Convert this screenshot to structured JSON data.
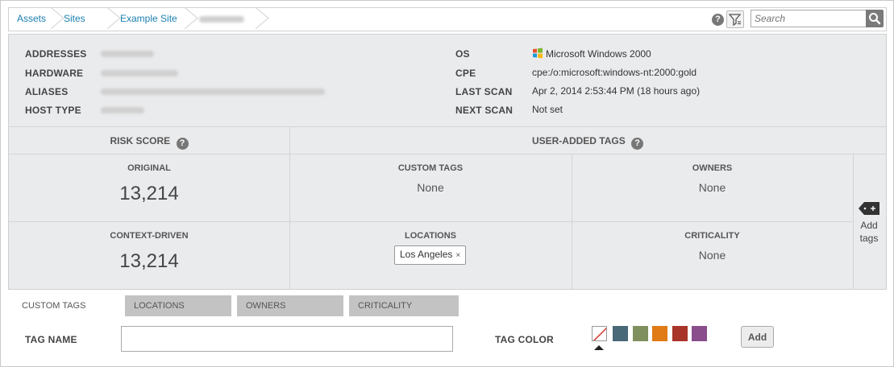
{
  "breadcrumb": {
    "items": [
      "Assets",
      "Sites",
      "Example Site"
    ]
  },
  "search": {
    "placeholder": "Search"
  },
  "summary": {
    "labels": {
      "addresses": "ADDRESSES",
      "hardware": "HARDWARE",
      "aliases": "ALIASES",
      "host_type": "HOST TYPE",
      "os": "OS",
      "cpe": "CPE",
      "last_scan": "LAST SCAN",
      "next_scan": "NEXT SCAN"
    },
    "values": {
      "os": "Microsoft Windows 2000",
      "cpe": "cpe:/o:microsoft:windows-nt:2000:gold",
      "last_scan": "Apr 2, 2014 2:53:44 PM (18 hours ago)",
      "next_scan": "Not set"
    }
  },
  "risk": {
    "header": "RISK SCORE",
    "original_label": "ORIGINAL",
    "original_value": "13,214",
    "context_label": "CONTEXT-DRIVEN",
    "context_value": "13,214"
  },
  "tags": {
    "header": "USER-ADDED TAGS",
    "custom_label": "CUSTOM TAGS",
    "custom_value": "None",
    "owners_label": "OWNERS",
    "owners_value": "None",
    "locations_label": "LOCATIONS",
    "location_tag": "Los Angeles",
    "location_remove": "×",
    "criticality_label": "CRITICALITY",
    "criticality_value": "None",
    "add_tags_label": "Add tags"
  },
  "editor": {
    "tabs": [
      "CUSTOM TAGS",
      "LOCATIONS",
      "OWNERS",
      "CRITICALITY"
    ],
    "tag_name_label": "TAG NAME",
    "tag_name_value": "",
    "tag_color_label": "TAG COLOR",
    "swatches": [
      "#496878",
      "#7f8f5e",
      "#e07b16",
      "#a8342a",
      "#8a4e8c"
    ],
    "add_label": "Add"
  },
  "icons": {
    "help": "help-icon",
    "filter": "filter-icon",
    "search": "search-icon",
    "os_logo": "windows-logo-icon",
    "add_tag": "tag-plus-icon"
  }
}
